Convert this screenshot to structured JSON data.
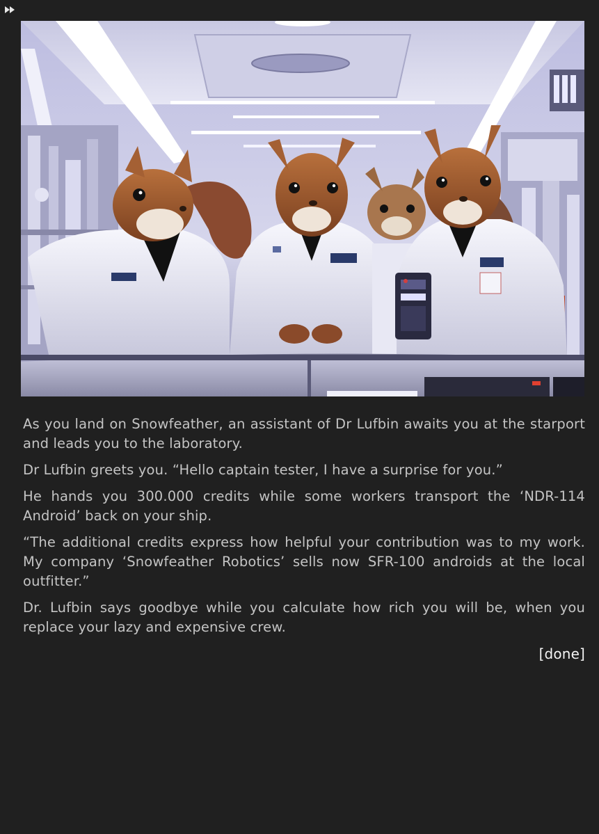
{
  "toolbar": {
    "fast_forward_icon": "fast-forward-icon"
  },
  "scene": {
    "image_subject": "squirrel-scientists-in-laboratory"
  },
  "story": {
    "paragraphs": [
      "As you land on Snowfeather, an assistant of Dr Lufbin awaits you at the starport and leads you to the laboratory.",
      "Dr Lufbin greets you. “Hello captain tester, I have a surprise for you.”",
      "He hands you 300.000 credits while some workers transport the ‘NDR-114 Android’ back on your ship.",
      "“The additional credits express how helpful your contribution was to my work. My company ‘Snowfeather Robotics’ sells now SFR-100 androids at the local outfitter.”",
      "Dr. Lufbin says goodbye while you calculate how rich you will be, when you replace your lazy and expensive crew."
    ],
    "done_label": "[done]"
  },
  "colors": {
    "background": "#202020",
    "text": "#c4c4c4",
    "link": "#f4f4f4"
  }
}
